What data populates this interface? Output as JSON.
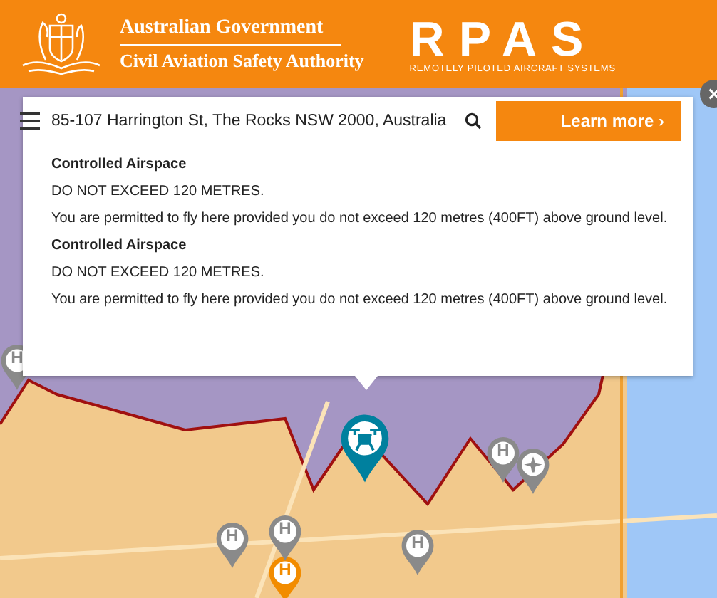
{
  "header": {
    "gov_line": "Australian Government",
    "agency_line": "Civil Aviation Safety Authority",
    "logo_text": "RPAS",
    "logo_subtitle": "REMOTELY PILOTED AIRCRAFT SYSTEMS"
  },
  "search": {
    "value": "85-107 Harrington St, The Rocks NSW 2000, Australia"
  },
  "learn_more": {
    "label": "Learn more ›"
  },
  "results": [
    {
      "title": "Controlled Airspace",
      "limit": "DO NOT EXCEED 120 METRES.",
      "detail": "You are permitted to fly here provided you do not exceed 120 metres (400FT) above ground level."
    },
    {
      "title": "Controlled Airspace",
      "limit": "DO NOT EXCEED 120 METRES.",
      "detail": "You are permitted to fly here provided you do not exceed 120 metres (400FT) above ground level."
    }
  ],
  "markers": [
    {
      "kind": "helipad",
      "label": "H",
      "color": "#8a8a8a"
    },
    {
      "kind": "drone",
      "color": "#00809e"
    },
    {
      "kind": "helipad",
      "label": "H",
      "color": "#8a8a8a"
    },
    {
      "kind": "aircraft",
      "color": "#8a8a8a"
    },
    {
      "kind": "helipad",
      "label": "H",
      "color": "#f28c00"
    },
    {
      "kind": "helipad",
      "label": "H",
      "color": "#8a8a8a"
    },
    {
      "kind": "helipad",
      "label": "H",
      "color": "#8a8a8a"
    },
    {
      "kind": "helipad",
      "label": "H",
      "color": "#8a8a8a"
    }
  ]
}
